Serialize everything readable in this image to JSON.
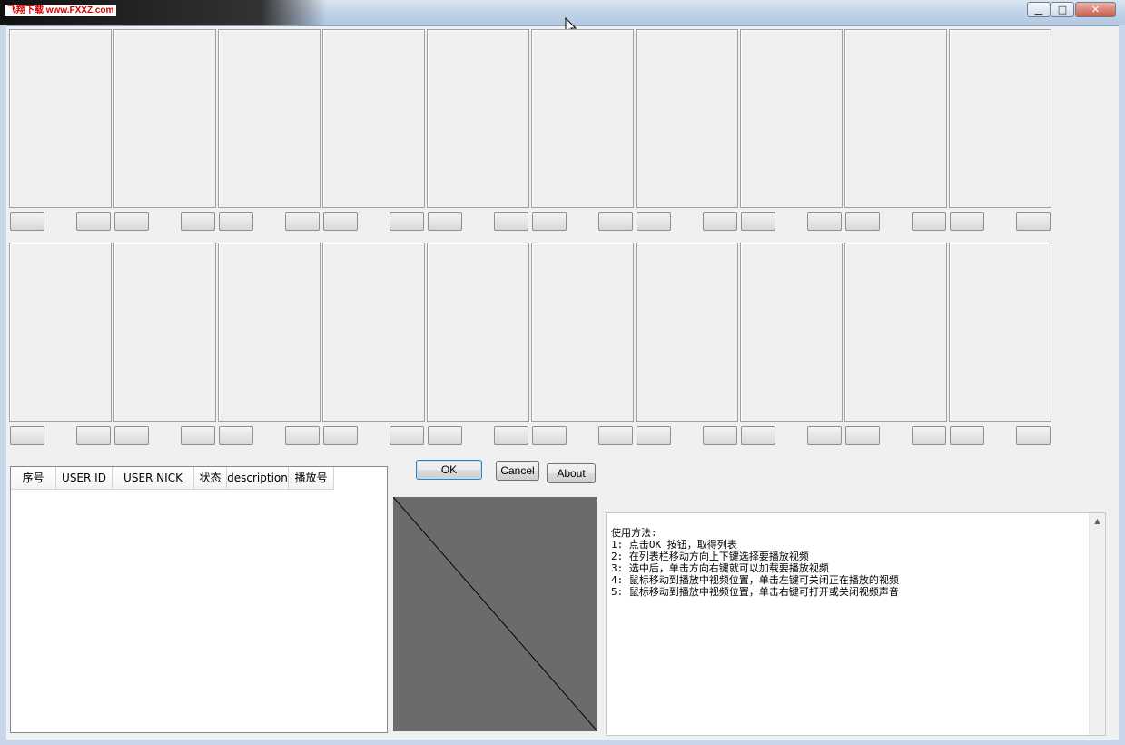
{
  "window": {
    "watermark": "飞翔下载 www.FXXZ.com",
    "minimize_glyph": "▁",
    "maximize_glyph": "□",
    "close_glyph": "✕"
  },
  "list": {
    "columns": [
      "序号",
      "USER ID",
      "USER  NICK",
      "状态",
      "description",
      "播放号"
    ]
  },
  "buttons": {
    "ok": "OK",
    "cancel": "Cancel",
    "about": "About"
  },
  "instructions": {
    "lines": [
      "使用方法:",
      "1: 点击OK 按钮，取得列表",
      "2: 在列表栏移动方向上下键选择要播放视频",
      "3: 选中后，单击方向右键就可以加载要播放视频",
      "4: 鼠标移动到播放中视频位置，单击左键可关闭正在播放的视频",
      "5: 鼠标移动到播放中视频位置，单击右键可打开或关闭视频声音"
    ],
    "scroll_up_glyph": "▲"
  },
  "colors": {
    "video_background": "#6b6b6b",
    "window_frame": "#c7d6e8"
  }
}
